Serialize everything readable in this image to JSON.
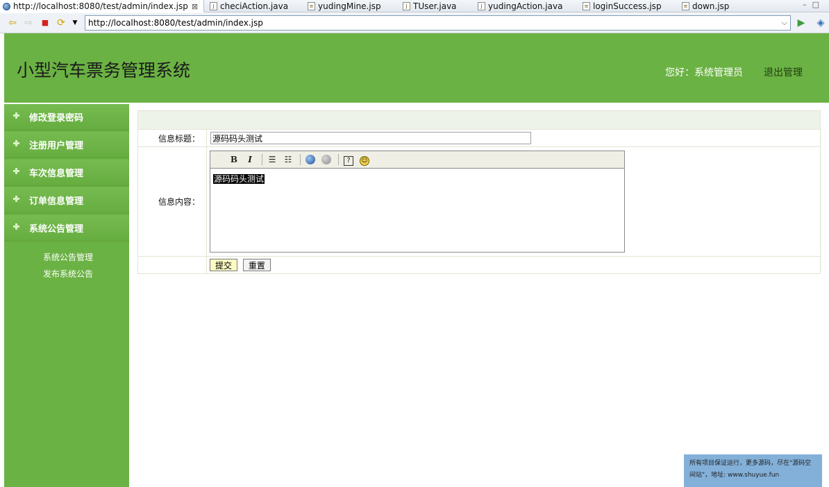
{
  "tabs": [
    {
      "label": "http://localhost:8080/test/admin/index.jsp",
      "icon": "globe-icon",
      "active": true
    },
    {
      "label": "checiAction.java",
      "icon": "java-file-icon"
    },
    {
      "label": "yudingMine.jsp",
      "icon": "jsp-file-icon"
    },
    {
      "label": "TUser.java",
      "icon": "java-file-icon"
    },
    {
      "label": "yudingAction.java",
      "icon": "java-file-icon"
    },
    {
      "label": "loginSuccess.jsp",
      "icon": "jsp-file-icon"
    },
    {
      "label": "down.jsp",
      "icon": "jsp-file-icon"
    }
  ],
  "browser": {
    "url": "http://localhost:8080/test/admin/index.jsp"
  },
  "header": {
    "title": "小型汽车票务管理系统",
    "greeting": "您好：系统管理员",
    "logout": "退出管理"
  },
  "sidebar": {
    "items": [
      {
        "label": "修改登录密码"
      },
      {
        "label": "注册用户管理"
      },
      {
        "label": "车次信息管理"
      },
      {
        "label": "订单信息管理"
      },
      {
        "label": "系统公告管理"
      }
    ],
    "subitems": [
      {
        "label": "系统公告管理"
      },
      {
        "label": "发布系统公告"
      }
    ]
  },
  "form": {
    "title_label": "信息标题：",
    "title_value": "源码码头测试",
    "content_label": "信息内容：",
    "content_value": "源码码头测试",
    "submit_label": "提交",
    "reset_label": "重置"
  },
  "editor_toolbar": {
    "bold": "B",
    "italic": "I",
    "help": "?"
  },
  "notice": {
    "text": "所有项目保证运行，更多源码，尽在\"源码空间站\"，地址: www.shuyue.fun"
  },
  "colors": {
    "header_bg": "#6bb244",
    "sidebar_bg": "#6bb244",
    "notice_bg": "#83b0d9"
  }
}
